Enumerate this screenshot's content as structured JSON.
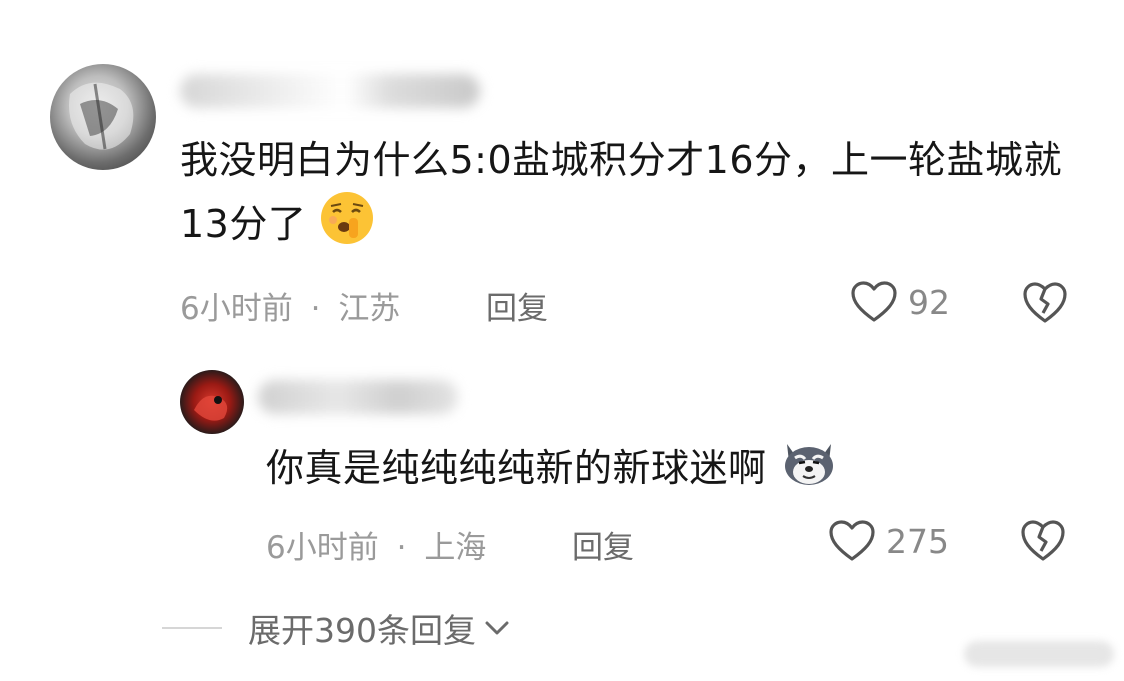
{
  "comments": [
    {
      "text_before_emoji": "我没明白为什么5:0盐城积分才16分，上一轮盐城就13分了",
      "emoji_icon": "shushing-face-emoji",
      "time": "6小时前",
      "separator": "·",
      "location": "江苏",
      "reply_label": "回复",
      "like_count": "92"
    },
    {
      "text_before_emoji": "你真是纯纯纯纯新的新球迷啊",
      "emoji_icon": "husky-dog-emoji",
      "time": "6小时前",
      "separator": "·",
      "location": "上海",
      "reply_label": "回复",
      "like_count": "275"
    }
  ],
  "expand_replies": {
    "label": "展开390条回复"
  },
  "icons": {
    "like": "heart-outline-icon",
    "dislike": "broken-heart-icon",
    "expand": "chevron-down-icon"
  },
  "colors": {
    "text": "#161616",
    "meta": "#9a9a9a",
    "action": "#6b6b6b",
    "icon": "#555555"
  }
}
